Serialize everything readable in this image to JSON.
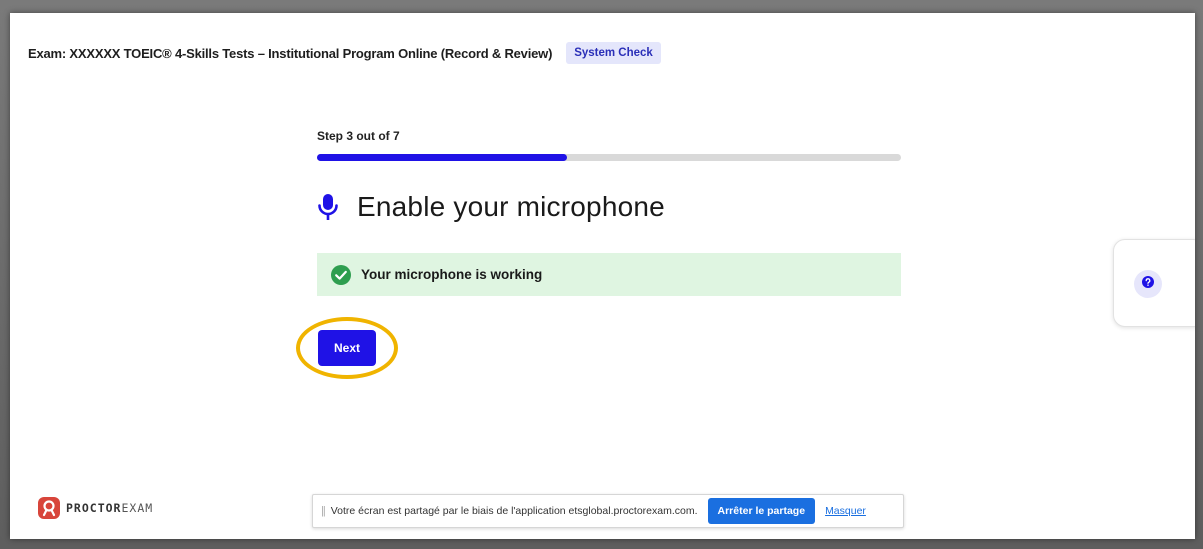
{
  "header": {
    "exam_title": "Exam: XXXXXX TOEIC® 4-Skills Tests – Institutional Program Online (Record & Review)",
    "badge": "System Check"
  },
  "step": {
    "label": "Step 3 out of 7",
    "current": 3,
    "total": 7
  },
  "main": {
    "heading": "Enable your microphone",
    "heading_icon": "microphone-icon",
    "status_text": "Your microphone is working",
    "status_icon": "check-circle-icon",
    "next_label": "Next"
  },
  "help": {
    "icon": "question-icon"
  },
  "logo": {
    "bold": "PROCTOR",
    "thin": "EXAM"
  },
  "share_bar": {
    "message": "Votre écran est partagé par le biais de l'application etsglobal.proctorexam.com.",
    "stop_label": "Arrêter le partage",
    "hide_label": "Masquer"
  },
  "colors": {
    "accent": "#1f12e6",
    "success_bg": "#dff5e1",
    "success_icon": "#2e9e4f",
    "highlight": "#f0b400",
    "share_button": "#1a6fe0",
    "logo_red": "#d8453b"
  }
}
